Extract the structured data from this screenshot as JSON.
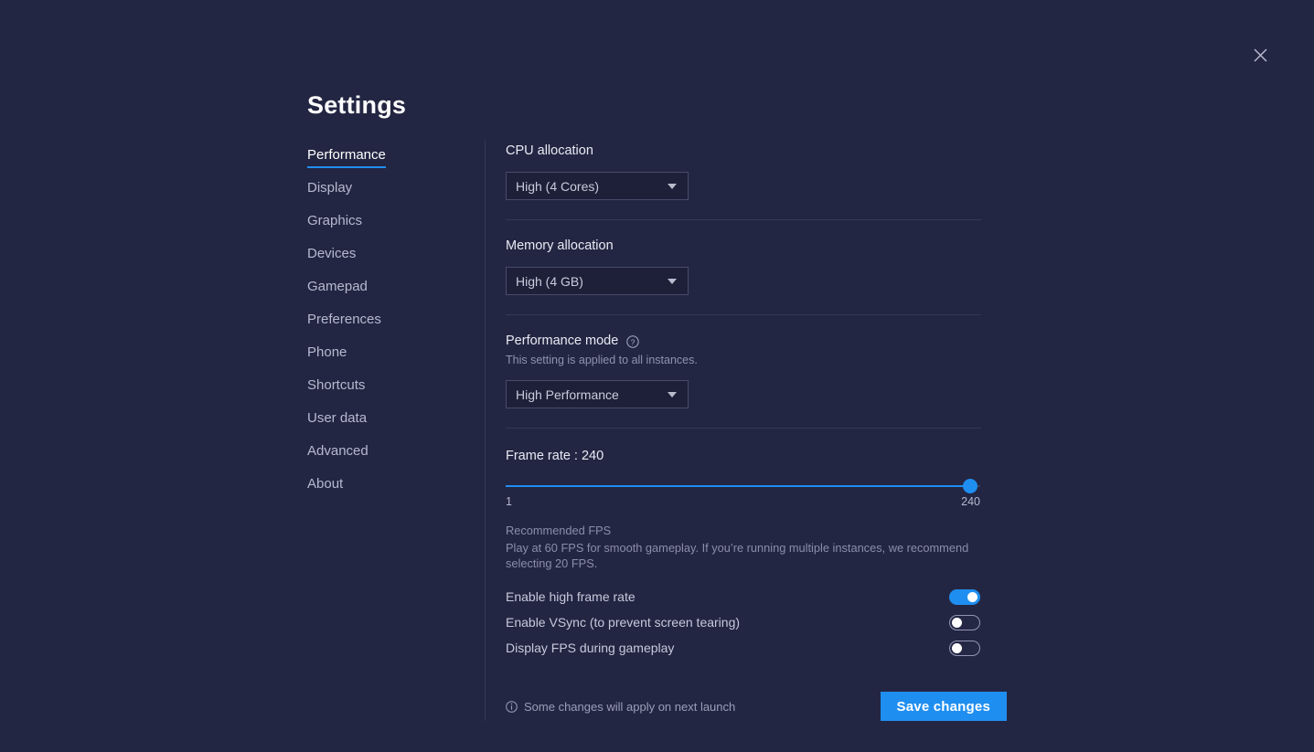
{
  "window": {
    "title": "Settings",
    "close_icon": "close-icon"
  },
  "sidebar": {
    "items": [
      {
        "label": "Performance",
        "active": true
      },
      {
        "label": "Display",
        "active": false
      },
      {
        "label": "Graphics",
        "active": false
      },
      {
        "label": "Devices",
        "active": false
      },
      {
        "label": "Gamepad",
        "active": false
      },
      {
        "label": "Preferences",
        "active": false
      },
      {
        "label": "Phone",
        "active": false
      },
      {
        "label": "Shortcuts",
        "active": false
      },
      {
        "label": "User data",
        "active": false
      },
      {
        "label": "Advanced",
        "active": false
      },
      {
        "label": "About",
        "active": false
      }
    ]
  },
  "content": {
    "cpu": {
      "label": "CPU allocation",
      "value": "High (4 Cores)"
    },
    "memory": {
      "label": "Memory allocation",
      "value": "High (4 GB)"
    },
    "performance_mode": {
      "label": "Performance mode",
      "help_icon": "help-circle-icon",
      "note": "This setting is applied to all instances.",
      "value": "High Performance"
    },
    "frame_rate": {
      "label": "Frame rate : 240",
      "value": 240,
      "min": 1,
      "max": 240,
      "min_label": "1",
      "max_label": "240",
      "recommended_title": "Recommended FPS",
      "recommended_text": "Play at 60 FPS for smooth gameplay. If you’re running multiple instances, we recommend selecting 20 FPS."
    },
    "toggles": [
      {
        "label": "Enable high frame rate",
        "state": "on"
      },
      {
        "label": "Enable VSync (to prevent screen tearing)",
        "state": "off"
      },
      {
        "label": "Display FPS during gameplay",
        "state": "off"
      }
    ]
  },
  "footer": {
    "info_icon": "info-circle-icon",
    "note": "Some changes will apply on next launch",
    "save_label": "Save changes"
  },
  "colors": {
    "background": "#232642",
    "accent": "#1f8ef1",
    "divider": "#343856",
    "field_bg": "#1e2039",
    "field_border": "#474b6b"
  }
}
